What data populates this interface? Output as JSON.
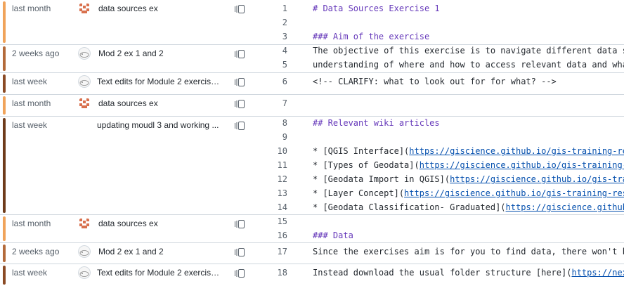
{
  "colors": {
    "age_recent": "#6e3b1a",
    "age_mid": "#b36a3a",
    "age_old": "#f0a35a"
  },
  "blame": [
    {
      "age": "last month",
      "message": "data sources ex",
      "avatar": "identicon-orange",
      "bar": "#f0a35a"
    },
    {
      "age": "2 weeks ago",
      "message": "Mod 2 ex 1 and 2",
      "avatar": "hamster-avatar",
      "bar": "#b36a3a"
    },
    {
      "age": "last week",
      "message": "Text edits for Module 2 exercises...",
      "avatar": "hamster-avatar",
      "bar": "#8a4a24"
    },
    {
      "age": "last month",
      "message": "data sources ex",
      "avatar": "identicon-orange",
      "bar": "#f0a35a"
    },
    {
      "age": "last week",
      "message": "updating moudl 3 and working ...",
      "avatar": "none",
      "bar": "#6e3b1a"
    },
    {
      "age": "last month",
      "message": "data sources ex",
      "avatar": "identicon-orange",
      "bar": "#f0a35a"
    },
    {
      "age": "2 weeks ago",
      "message": "Mod 2 ex 1 and 2",
      "avatar": "hamster-avatar",
      "bar": "#b36a3a"
    },
    {
      "age": "last week",
      "message": "Text edits for Module 2 exercises...",
      "avatar": "hamster-avatar",
      "bar": "#8a4a24"
    }
  ],
  "lines": [
    {
      "n": "1",
      "text": "# Data Sources Exercise 1"
    },
    {
      "n": "2",
      "text": ""
    },
    {
      "n": "3",
      "text": "### Aim of the exercise"
    },
    {
      "n": "4",
      "text": "The objective of this exercise is to navigate different data sou"
    },
    {
      "n": "5",
      "text": "understanding of where and how to access relevant data and what"
    },
    {
      "n": "6",
      "text": "<!-- CLARIFY: what to look out for for what? -->"
    },
    {
      "n": "7",
      "text": ""
    },
    {
      "n": "8",
      "text": "## Relevant wiki articles"
    },
    {
      "n": "9",
      "text": ""
    },
    {
      "n": "10",
      "pre": "* [QGIS Interface](",
      "url": "https://giscience.github.io/gis-training-reso"
    },
    {
      "n": "11",
      "pre": "* [Types of Geodata](",
      "url": "https://giscience.github.io/gis-training-re"
    },
    {
      "n": "12",
      "pre": "* [Geodata Import in QGIS](",
      "url": "https://giscience.github.io/gis-trai"
    },
    {
      "n": "13",
      "pre": "* [Layer Concept](",
      "url": "https://giscience.github.io/gis-training-resou"
    },
    {
      "n": "14",
      "pre": "* [Geodata Classification- Graduated](",
      "url": "https://giscience.github.i"
    },
    {
      "n": "15",
      "text": ""
    },
    {
      "n": "16",
      "text": "### Data"
    },
    {
      "n": "17",
      "text": "Since the exercises aim is for you to find data, there won't be"
    },
    {
      "n": "18",
      "pre": "Instead download the usual folder structure [here](",
      "url": "https://nexus"
    }
  ]
}
